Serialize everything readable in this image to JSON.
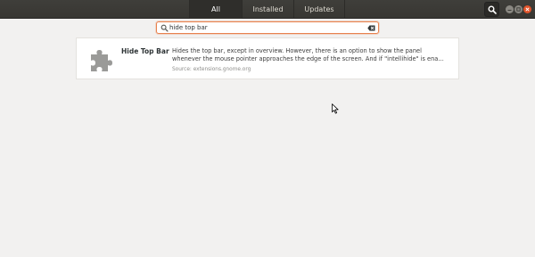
{
  "header": {
    "tabs": [
      {
        "label": "All",
        "active": true
      },
      {
        "label": "Installed",
        "active": false
      },
      {
        "label": "Updates",
        "active": false
      }
    ],
    "search_toggle_icon": "search-icon",
    "window_controls": [
      "minimize-icon",
      "maximize-icon",
      "close-icon"
    ]
  },
  "search": {
    "value": "hide top bar",
    "icons": [
      "search-icon",
      "clear-icon"
    ]
  },
  "results": [
    {
      "name": "Hide Top Bar",
      "icon": "puzzle-icon",
      "description": "Hides the top bar, except in overview. However, there is an option to show the panel whenever the mouse pointer approaches the edge of the screen. And if \"intellihide\" is ena…",
      "source": "Source: extensions.gnome.org"
    }
  ],
  "colors": {
    "titlebar": "#3c3b37",
    "accent": "#e95420",
    "background": "#f2f1f0"
  }
}
